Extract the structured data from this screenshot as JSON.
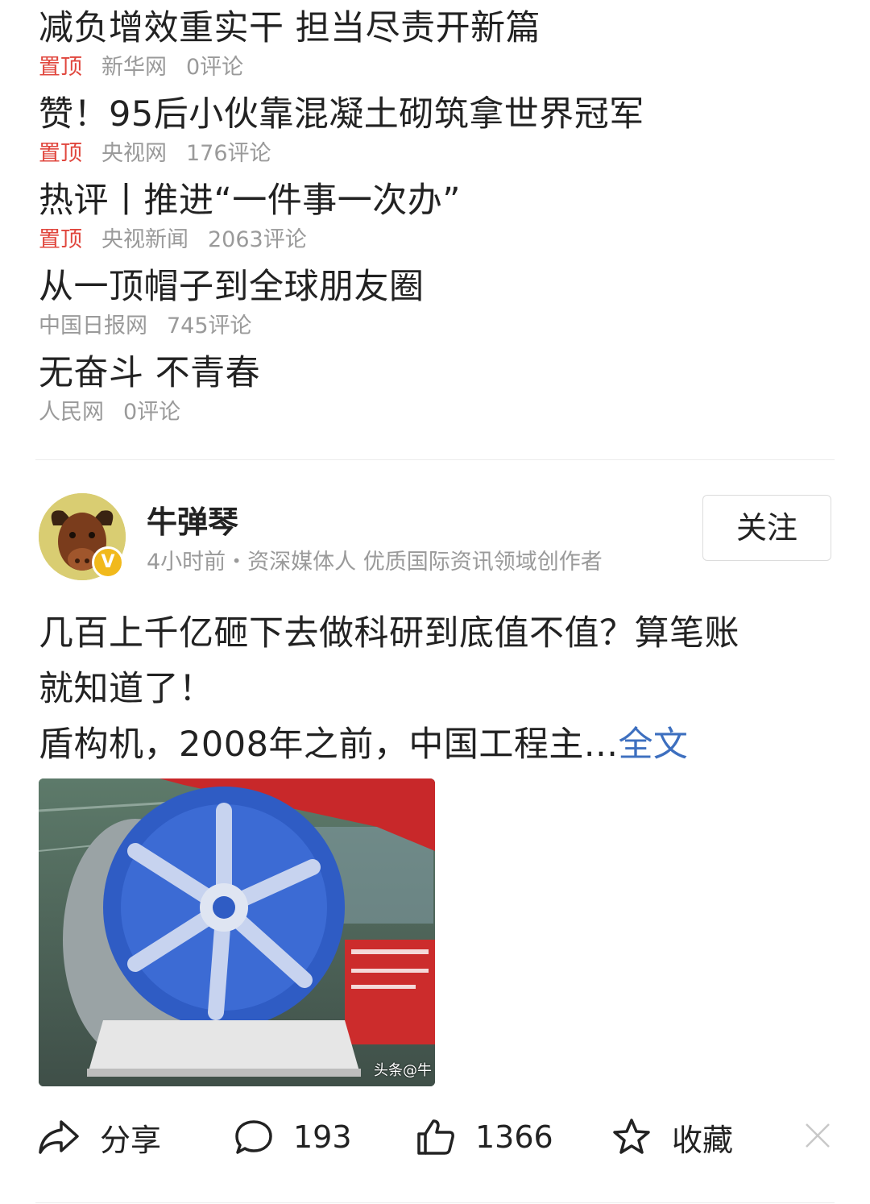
{
  "news": [
    {
      "title": "减负增效重实干 担当尽责开新篇",
      "pinned": "置顶",
      "source": "新华网",
      "comments": "0评论"
    },
    {
      "title": "赞！95后小伙靠混凝土砌筑拿世界冠军",
      "pinned": "置顶",
      "source": "央视网",
      "comments": "176评论"
    },
    {
      "title": "热评丨推进“一件事一次办”",
      "pinned": "置顶",
      "source": "央视新闻",
      "comments": "2063评论"
    },
    {
      "title": "从一顶帽子到全球朋友圈",
      "pinned": "",
      "source": "中国日报网",
      "comments": "745评论"
    },
    {
      "title": "无奋斗 不青春",
      "pinned": "",
      "source": "人民网",
      "comments": "0评论"
    }
  ],
  "post": {
    "author": "牛弹琴",
    "verified_badge": "V",
    "meta": "4小时前・资深媒体人 优质国际资讯领域创作者",
    "follow_label": "关注",
    "text_line1": "几百上千亿砸下去做科研到底值不值？算笔账",
    "text_line2": "就知道了！",
    "text_line3": "盾构机，2008年之前，中国工程主...",
    "full_text_link": "全文",
    "image_watermark": "头条@牛"
  },
  "actions": {
    "share_label": "分享",
    "comment_count": "193",
    "like_count": "1366",
    "favorite_label": "收藏"
  },
  "icons": {
    "share": "share-icon",
    "comment": "comment-icon",
    "like": "thumbs-up-icon",
    "favorite": "star-icon",
    "close": "close-icon"
  },
  "colors": {
    "pinned": "#e0463d",
    "link": "#3d6fbf",
    "meta": "#9a9a9a",
    "badge": "#f1b91c"
  }
}
